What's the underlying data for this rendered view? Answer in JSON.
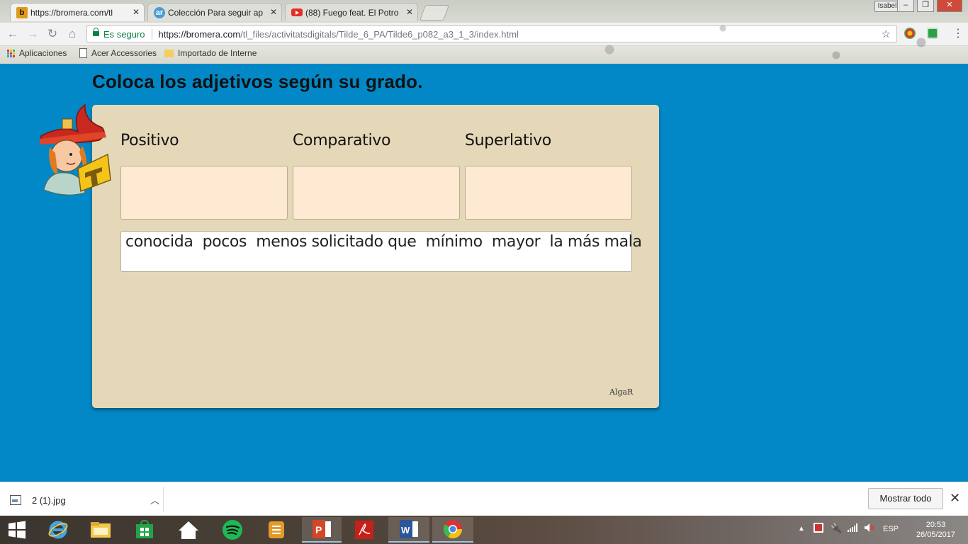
{
  "browser": {
    "tabs": [
      {
        "title": "https://bromera.com/tl",
        "favicon": "b",
        "active": true
      },
      {
        "title": "Colección Para seguir ap",
        "favicon": "ar",
        "active": false
      },
      {
        "title": "(88) Fuego feat. El Potro",
        "favicon": "youtube",
        "active": false
      }
    ],
    "profile_name": "Isabel",
    "secure_label": "Es seguro",
    "url_host": "https://bromera.com",
    "url_path": "/tl_files/activitatsdigitals/Tilde_6_PA/Tilde6_p082_a3_1_3/index.html",
    "bookmarks": [
      "Aplicaciones",
      "Acer Accessories",
      "Importado de Interne"
    ]
  },
  "activity": {
    "title": "Coloca los adjetivos según su grado.",
    "columns": [
      "Positivo",
      "Comparativo",
      "Superlativo"
    ],
    "words": [
      "conocida",
      "pocos",
      "menos solicitado que",
      "mínimo",
      "mayor",
      "la más mala"
    ],
    "publisher_logo": "AlgaR"
  },
  "download_bar": {
    "file_name": "2 (1).jpg",
    "show_all_label": "Mostrar todo"
  },
  "taskbar": {
    "language": "ESP",
    "time": "20:53",
    "date": "26/05/2017"
  },
  "colors": {
    "page_background": "#0288c6",
    "panel_background": "#e4d8b9",
    "dropzone_background": "#feead3",
    "secure_green": "#0b8043"
  }
}
